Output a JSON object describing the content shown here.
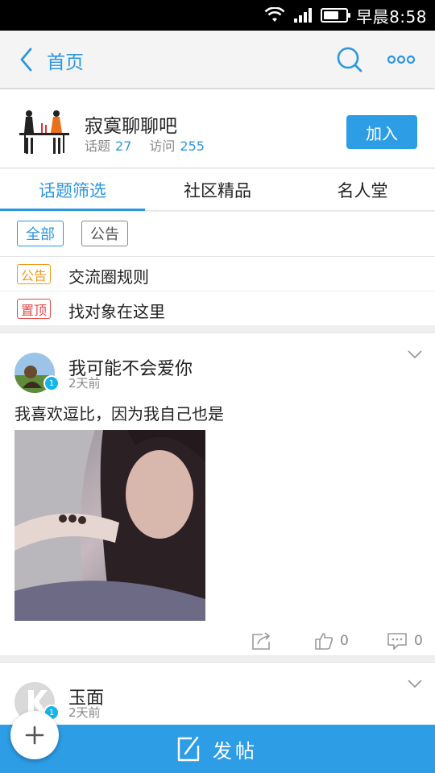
{
  "status_bar": {
    "time": "早晨8:58",
    "battery_level": 0.7,
    "icons": [
      "wifi-icon",
      "signal-icon",
      "battery-icon"
    ]
  },
  "nav": {
    "back_icon": "chevron-left-icon",
    "title": "首页",
    "search_icon": "search-icon",
    "more_icon": "more-dots-icon"
  },
  "community": {
    "name": "寂寞聊聊吧",
    "topics_label": "话题",
    "topics_count": "27",
    "visits_label": "访问",
    "visits_count": "255",
    "join_label": "加入"
  },
  "tabs": [
    {
      "label": "话题筛选",
      "active": true
    },
    {
      "label": "社区精品",
      "active": false
    },
    {
      "label": "名人堂",
      "active": false
    }
  ],
  "filters": {
    "all_label": "全部",
    "notice_label": "公告"
  },
  "pinned": [
    {
      "tag": "公告",
      "text": "交流圈规则",
      "color": "#f09a1c"
    },
    {
      "tag": "置顶",
      "text": "找对象在这里",
      "color": "#e54848"
    }
  ],
  "posts": [
    {
      "author": "我可能不会爱你",
      "time": "2天前",
      "level": "1",
      "content": "我喜欢逗比，因为我自己也是",
      "like_count": "0",
      "comment_count": "0"
    },
    {
      "author": "玉面",
      "time": "2天前",
      "level": "1"
    }
  ],
  "bottom_bar": {
    "label": "发帖",
    "icon": "compose-icon"
  },
  "fab": {
    "icon": "plus-icon"
  },
  "colors": {
    "accent": "#2c97de",
    "button": "#2d9de6",
    "notice": "#f09a1c",
    "pinned": "#e54848",
    "level_badge": "#13b5ea"
  }
}
